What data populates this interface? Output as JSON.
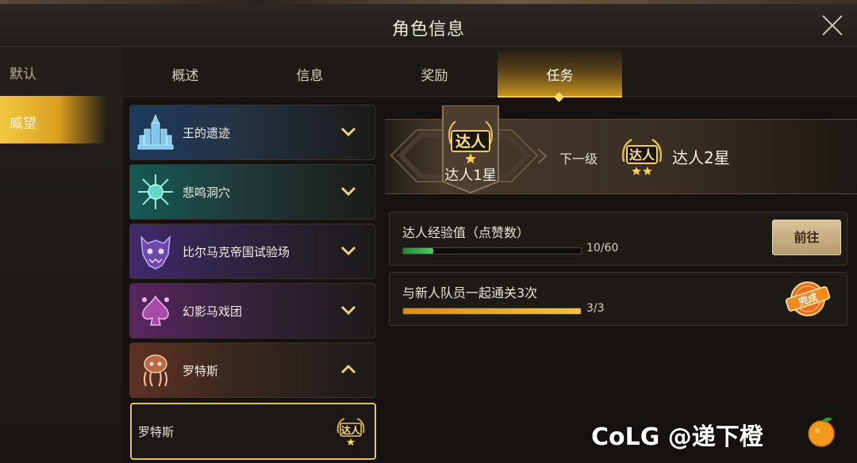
{
  "window": {
    "title": "角色信息"
  },
  "left_nav": {
    "items": [
      {
        "label": "默认"
      },
      {
        "label": "威望"
      }
    ]
  },
  "tabs": [
    {
      "label": "概述"
    },
    {
      "label": "信息"
    },
    {
      "label": "奖励"
    },
    {
      "label": "任务"
    }
  ],
  "active_tab": "任务",
  "dungeons": [
    {
      "name": "王的遗迹",
      "icon": "ruins-icon",
      "expanded": false,
      "color": "#2a5a8a"
    },
    {
      "name": "悲鸣洞穴",
      "icon": "crystal-icon",
      "expanded": false,
      "color": "#1d7a72"
    },
    {
      "name": "比尔马克帝国试验场",
      "icon": "demon-mask-icon",
      "expanded": false,
      "color": "#5a3a8a"
    },
    {
      "name": "幻影马戏团",
      "icon": "spade-icon",
      "expanded": false,
      "color": "#7a2f7a"
    },
    {
      "name": "罗特斯",
      "icon": "squid-icon",
      "expanded": true,
      "color": "#7a4430"
    }
  ],
  "sub_item": {
    "name": "罗特斯",
    "badge": "达人"
  },
  "rank": {
    "current_badge": "达人",
    "current_name": "达人1星",
    "next_label": "下一级",
    "next_badge": "达人",
    "next_name": "达人2星"
  },
  "quests": [
    {
      "text": "达人经验值（点赞数）",
      "progress_text": "10/60",
      "progress": 0.1667,
      "action_label": "前往",
      "completed": false
    },
    {
      "text": "与新人队员一起通关3次",
      "progress_text": "3/3",
      "progress": 1.0,
      "stamp_text": "完成",
      "completed": true
    }
  ],
  "watermark": {
    "text": "CoLG @递下橙"
  },
  "colors": {
    "accent_gold": "#f3c842",
    "green_bar": "#2ea84a",
    "orange_bar": "#f2a21c",
    "stamp_orange": "#f08a1c"
  }
}
